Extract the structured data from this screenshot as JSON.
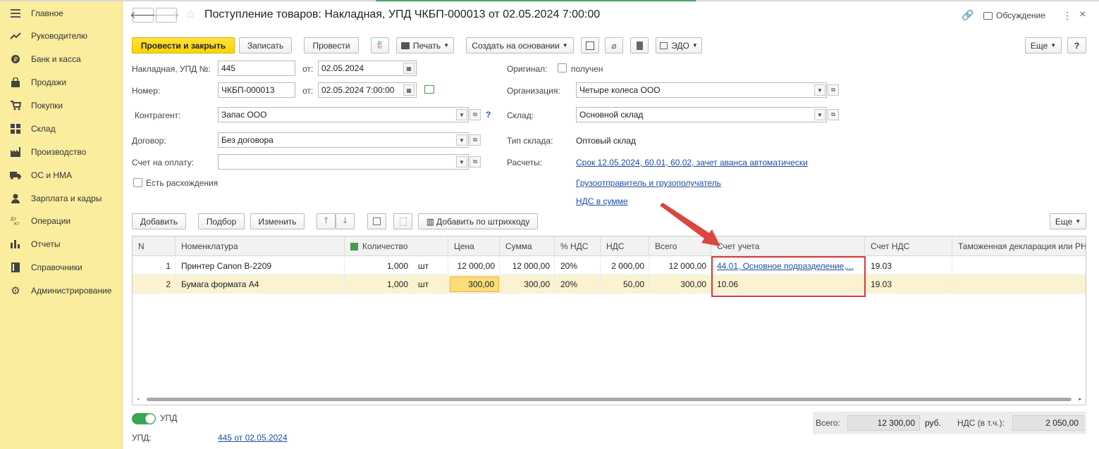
{
  "sidebar": {
    "items": [
      {
        "label": "Главное",
        "icon": "menu-icon"
      },
      {
        "label": "Руководителю",
        "icon": "trend-icon"
      },
      {
        "label": "Банк и касса",
        "icon": "coin-icon"
      },
      {
        "label": "Продажи",
        "icon": "bag-icon"
      },
      {
        "label": "Покупки",
        "icon": "cart-icon"
      },
      {
        "label": "Склад",
        "icon": "warehouse-icon"
      },
      {
        "label": "Производство",
        "icon": "factory-icon"
      },
      {
        "label": "ОС и НМА",
        "icon": "truck-icon"
      },
      {
        "label": "Зарплата и кадры",
        "icon": "person-icon"
      },
      {
        "label": "Операции",
        "icon": "dt-kt-icon"
      },
      {
        "label": "Отчеты",
        "icon": "bar-chart-icon"
      },
      {
        "label": "Справочники",
        "icon": "book-icon"
      },
      {
        "label": "Администрирование",
        "icon": "gear-icon"
      }
    ]
  },
  "header": {
    "title": "Поступление товаров: Накладная, УПД ЧКБП-000013 от 02.05.2024 7:00:00",
    "discussion": "Обсуждение"
  },
  "toolbar": {
    "post_close": "Провести и закрыть",
    "save": "Записать",
    "post": "Провести",
    "dtkt": "Дт Кт",
    "print": "Печать",
    "create_based": "Создать на основании",
    "edo": "ЭДО",
    "more": "Еще",
    "help": "?"
  },
  "form": {
    "invoice_label": "Накладная, УПД №:",
    "invoice_value": "445",
    "from_label": "от:",
    "invoice_date": "02.05.2024",
    "number_label": "Номер:",
    "number_value": "ЧКБП-000013",
    "number_date": "02.05.2024  7:00:00",
    "counterparty_label": "Контрагент:",
    "counterparty_value": "Запас ООО",
    "contract_label": "Договор:",
    "contract_value": "Без договора",
    "payment_label": "Счет на оплату:",
    "payment_value": "",
    "discrepancy_label": "Есть расхождения",
    "original_label": "Оригинал:",
    "original_check": "получен",
    "org_label": "Организация:",
    "org_value": "Четыре колеса ООО",
    "warehouse_label": "Склад:",
    "warehouse_value": "Основной склад",
    "wh_type_label": "Тип склада:",
    "wh_type_value": "Оптовый склад",
    "settlements_label": "Расчеты:",
    "settlements_link": "Срок 12.05.2024, 60.01, 60.02, зачет аванса автоматически",
    "shipper_link": "Грузоотправитель и грузополучатель",
    "vat_link": "НДС в сумме"
  },
  "table_toolbar": {
    "add": "Добавить",
    "pick": "Подбор",
    "change": "Изменить",
    "barcode": "Добавить по штрихкоду",
    "more": "Еще"
  },
  "table": {
    "columns": [
      "N",
      "Номенклатура",
      "Количество",
      "Цена",
      "Сумма",
      "% НДС",
      "НДС",
      "Всего",
      "Счет учета",
      "Счет НДС",
      "Таможенная декларация или РНПТ"
    ],
    "rows": [
      {
        "n": "1",
        "name": "Принтер Canon B-2209",
        "qty": "1,000",
        "unit": "шт",
        "price": "12 000,00",
        "sum": "12 000,00",
        "vat_rate": "20%",
        "vat": "2 000,00",
        "total": "12 000,00",
        "account": "44.01, Основное подразделение,...",
        "vat_account": "19.03"
      },
      {
        "n": "2",
        "name": "Бумага формата А4",
        "qty": "1,000",
        "unit": "шт",
        "price": "300,00",
        "sum": "300,00",
        "vat_rate": "20%",
        "vat": "50,00",
        "total": "300,00",
        "account": "10.06",
        "vat_account": "19.03"
      }
    ]
  },
  "footer": {
    "upd_toggle": "УПД",
    "upd_label": "УПД:",
    "upd_link": "445 от 02.05.2024",
    "total_label": "Всего:",
    "total_value": "12 300,00",
    "currency": "руб.",
    "vat_label": "НДС (в т.ч.):",
    "vat_value": "2 050,00"
  },
  "colors": {
    "accent": "#fcd403",
    "sidebar": "#fbed9e",
    "highlight": "#d9383a",
    "link": "#1c4ea6"
  }
}
